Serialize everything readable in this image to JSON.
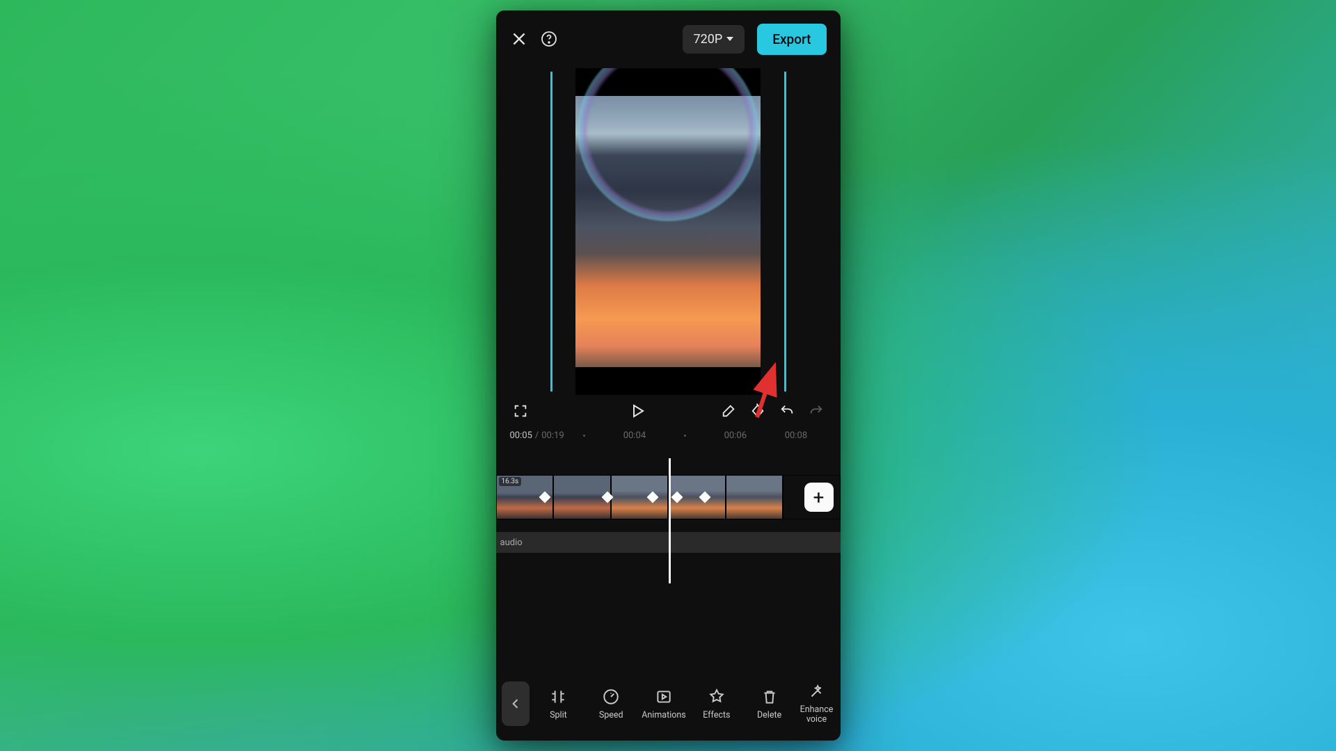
{
  "header": {
    "resolution": "720P",
    "export": "Export"
  },
  "timecode": {
    "current": "00:05",
    "total": "00:19",
    "marks": [
      "00:04",
      "00:06",
      "00:08"
    ]
  },
  "clip": {
    "label": "16.3s"
  },
  "audioTrack": {
    "label": "audio"
  },
  "kfPositions": [
    70,
    160,
    225,
    260,
    300
  ],
  "tools": [
    {
      "id": "split",
      "label": "Split"
    },
    {
      "id": "speed",
      "label": "Speed"
    },
    {
      "id": "animations",
      "label": "Animations"
    },
    {
      "id": "effects",
      "label": "Effects"
    },
    {
      "id": "delete",
      "label": "Delete"
    },
    {
      "id": "enhance-voice",
      "label": "Enhance voice"
    }
  ]
}
